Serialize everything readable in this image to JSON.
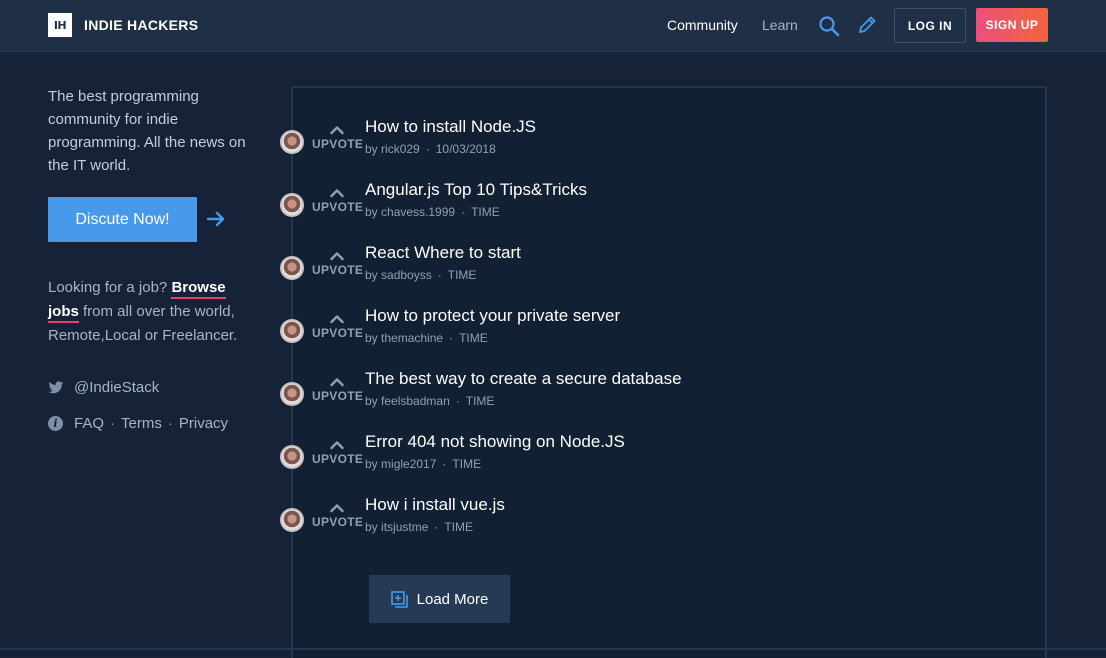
{
  "header": {
    "logo_mark": "IH",
    "logo_text": "INDIE HACKERS",
    "nav": {
      "community": "Community",
      "learn": "Learn"
    },
    "login": "LOG IN",
    "signup": "SIGN UP"
  },
  "sidebar": {
    "tagline": "The best programming community for indie programming. All the news on the IT world.",
    "discuss_button": "Discute Now!",
    "jobs_prefix": "Looking for a job?",
    "jobs_link_1": "Browse",
    "jobs_link_2": "jobs",
    "jobs_suffix": "from all over the world, Remote,Local or Freelancer.",
    "twitter_handle": "@IndieStack",
    "links": {
      "faq": "FAQ",
      "terms": "Terms",
      "privacy": "Privacy"
    },
    "separator": "·"
  },
  "feed": {
    "upvote_label": "UPVOTE",
    "posts": [
      {
        "title": "How to install Node.JS",
        "author": "rick029",
        "time": "10/03/2018"
      },
      {
        "title": "Angular.js Top 10 Tips&Tricks",
        "author": "chavess.1999",
        "time": "TIME"
      },
      {
        "title": "React Where to start",
        "author": "sadboyss",
        "time": "TIME"
      },
      {
        "title": "How to protect your private server",
        "author": "themachine",
        "time": "TIME"
      },
      {
        "title": "The best way to create a secure database",
        "author": "feelsbadman",
        "time": "TIME"
      },
      {
        "title": "Error 404 not showing on Node.JS",
        "author": "migle2017",
        "time": "TIME"
      },
      {
        "title": "How i install vue.js",
        "author": "itsjustme",
        "time": "TIME"
      }
    ],
    "by_label": "by",
    "load_more": "Load More"
  },
  "colors": {
    "background": "#152237",
    "header": "#1f2f46",
    "accent_blue": "#4799eb",
    "signup_gradient_start": "#ea4f7c",
    "signup_gradient_end": "#f3653c",
    "link_underline": "#e9415f"
  },
  "icons": {
    "search": "search-icon",
    "pencil": "pencil-icon",
    "arrow": "arrow-right-icon",
    "twitter": "twitter-icon",
    "info": "info-icon",
    "upvote": "chevron-up-icon",
    "load_more": "add-box-icon"
  }
}
